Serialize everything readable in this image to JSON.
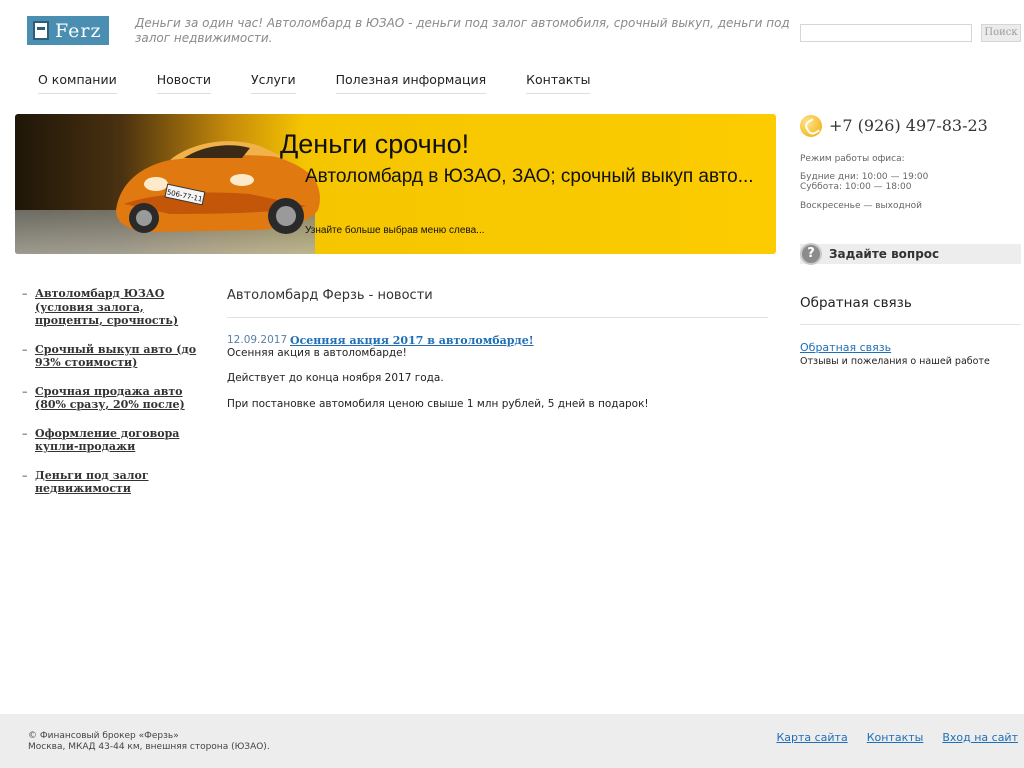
{
  "header": {
    "logo_text": "Ferz",
    "tagline": "Деньги за один час! Автоломбард в ЮЗАО - деньги под залог автомобиля, срочный выкуп, деньги под залог недвижимости.",
    "search": {
      "placeholder": "",
      "button_label": "Поиск"
    }
  },
  "nav": {
    "items": [
      {
        "label": "О компании"
      },
      {
        "label": "Новости"
      },
      {
        "label": "Услуги"
      },
      {
        "label": "Полезная информация"
      },
      {
        "label": "Контакты"
      }
    ]
  },
  "banner": {
    "title": "Деньги срочно!",
    "subtitle": "Автоломбард в ЮЗАО, ЗАО; срочный выкуп авто...",
    "note": "Узнайте больше выбрав меню слева...",
    "plate": "506-77-11"
  },
  "contact": {
    "phone": "+7 (926) 497-83-23",
    "hours_label": "Режим работы офиса:",
    "hours_weekdays": "Будние дни: 10:00 — 19:00",
    "hours_saturday": "Суббота: 10:00 — 18:00",
    "hours_sunday": "Воскресенье — выходной",
    "ask_label": "Задайте вопрос"
  },
  "feedback": {
    "title": "Обратная связь",
    "link": "Обратная связь",
    "description": "Отзывы и пожелания о нашей работе"
  },
  "sidemenu": {
    "dash": "–",
    "items": [
      {
        "label": "Автоломбард ЮЗАО (условия залога, проценты, срочность)"
      },
      {
        "label": "Срочный выкуп авто (до 93% стоимости)"
      },
      {
        "label": "Срочная продажа авто (80% сразу, 20% после)"
      },
      {
        "label": "Оформление договора купли-продажи"
      },
      {
        "label": "Деньги под залог недвижимости"
      }
    ]
  },
  "main": {
    "title": "Автоломбард Ферзь - новости",
    "news": {
      "date": "12.09.2017",
      "headline": "Осенняя акция 2017 в автоломбарде!",
      "paragraphs": [
        "Осенняя акция в автоломбарде!",
        "Действует до конца ноября 2017 года.",
        "При постановке автомобиля ценою свыше 1 млн рублей, 5 дней в подарок!"
      ]
    }
  },
  "footer": {
    "copyright": "© Финансовый брокер «Ферзь»",
    "address": "Москва, МКАД 43-44 км, внешняя сторона (ЮЗАО).",
    "links": [
      {
        "label": "Карта сайта"
      },
      {
        "label": "Контакты"
      },
      {
        "label": "Вход на сайт"
      }
    ]
  },
  "colors": {
    "banner_yellow": "#fccc00",
    "link_blue": "#1e6fb8",
    "footer_bg": "#ededed",
    "logo_bg": "#4a8fb2"
  }
}
